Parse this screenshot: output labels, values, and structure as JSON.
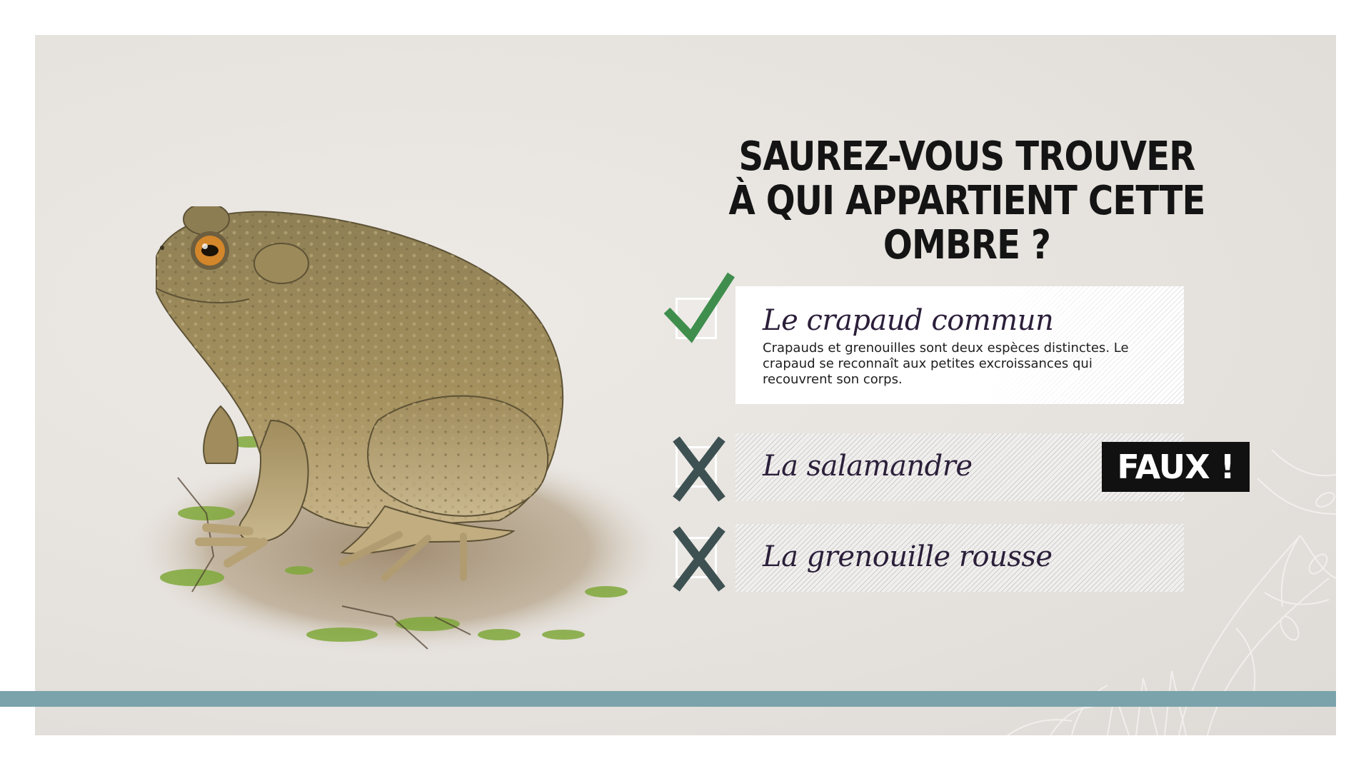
{
  "title": {
    "line1": "SAUREZ-VOUS TROUVER",
    "line2": "À QUI APPARTIENT CETTE OMBRE ?"
  },
  "answers": [
    {
      "label": "Le crapaud commun",
      "description": "Crapauds et grenouilles sont deux espèces distinctes. Le crapaud se reconnaît aux petites excroissances qui recouvrent son corps.",
      "state": "correct",
      "mark_icon": "check-icon"
    },
    {
      "label": "La salamandre",
      "state": "wrong",
      "mark_icon": "cross-icon"
    },
    {
      "label": "La grenouille rousse",
      "state": "wrong",
      "mark_icon": "cross-icon"
    }
  ],
  "feedback": {
    "label": "FAUX !"
  },
  "illustration": "common-toad",
  "colors": {
    "check": "#3f8e4e",
    "cross": "#3e5152",
    "band": "#7aa3ab",
    "feedback_bg": "#111111"
  }
}
